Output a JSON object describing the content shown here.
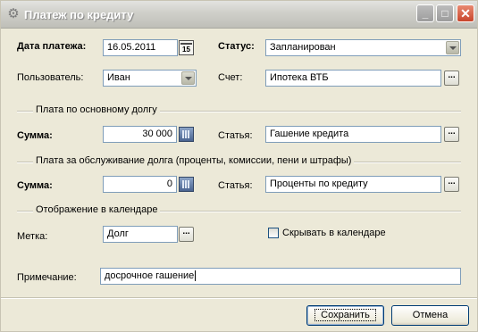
{
  "window": {
    "title": "Платеж по кредиту"
  },
  "form": {
    "date_label": "Дата платежа:",
    "date_value": "16.05.2011",
    "status_label": "Статус:",
    "status_value": "Запланирован",
    "user_label": "Пользователь:",
    "user_value": "Иван",
    "account_label": "Счет:",
    "account_value": "Ипотека ВТБ"
  },
  "principal_group": {
    "title": "Плата по основному долгу",
    "amount_label": "Сумма:",
    "amount_value": "30 000",
    "article_label": "Статья:",
    "article_value": "Гашение кредита"
  },
  "service_group": {
    "title": "Плата за обслуживание долга (проценты, комиссии, пени и штрафы)",
    "amount_label": "Сумма:",
    "amount_value": "0",
    "article_label": "Статья:",
    "article_value": "Проценты по кредиту"
  },
  "calendar_group": {
    "title": "Отображение в календаре",
    "tag_label": "Метка:",
    "tag_value": "Долг",
    "hide_label": "Скрывать в календаре",
    "hide_checked": false
  },
  "note": {
    "label": "Примечание:",
    "value": "досрочное гашение"
  },
  "buttons": {
    "save": "Сохранить",
    "cancel": "Отмена",
    "ellipsis": "..."
  },
  "colors": {
    "dialog_bg": "#ece9d8",
    "field_border": "#7f9db9",
    "button_border": "#003c74"
  }
}
